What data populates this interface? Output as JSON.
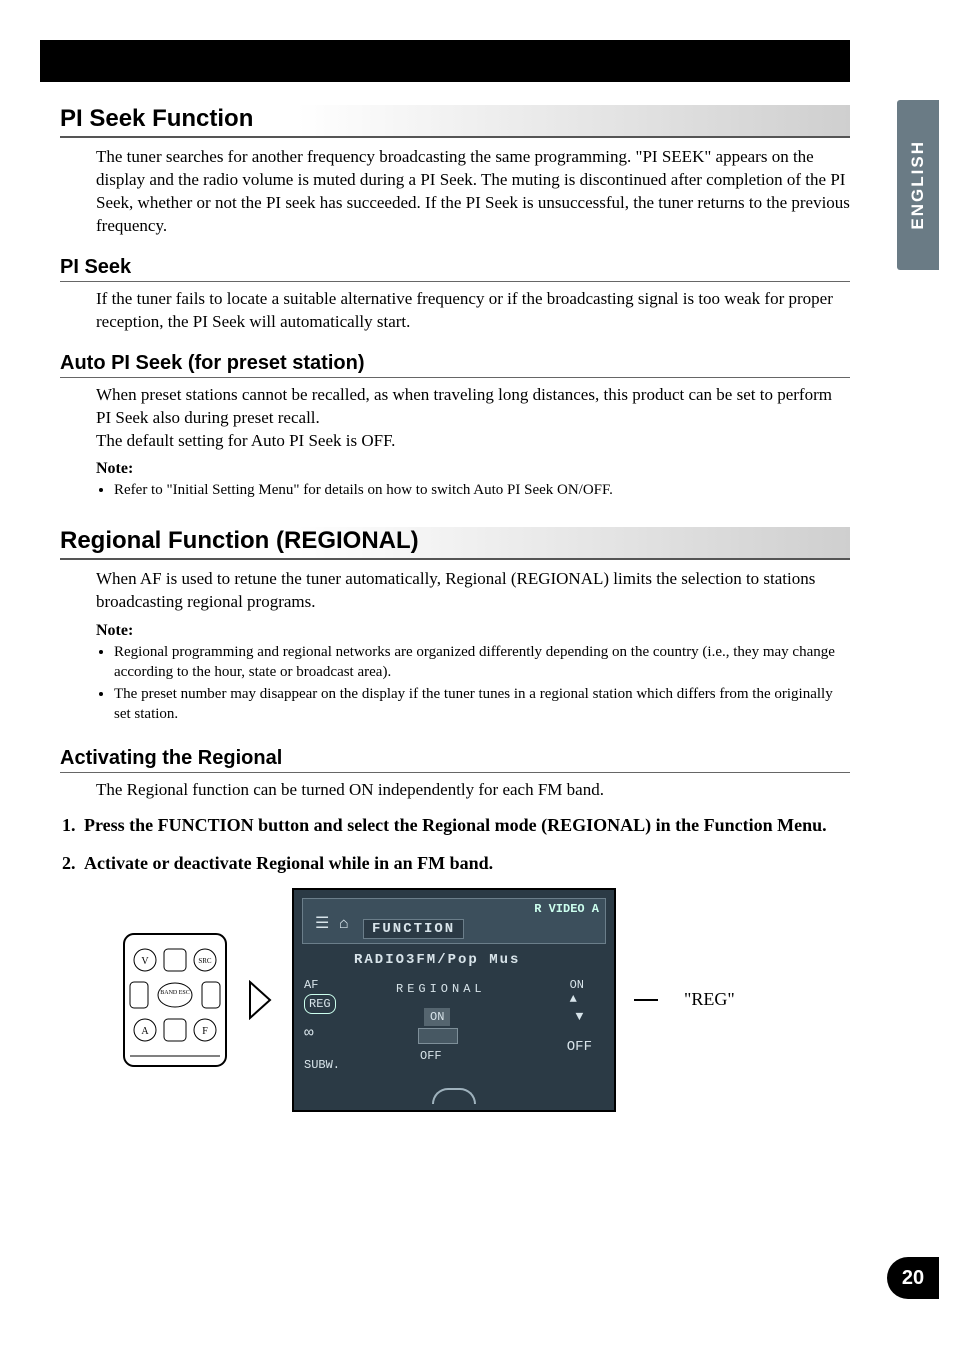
{
  "side_tab": "ENGLISH",
  "page_number": "20",
  "sections": {
    "pi_seek_function": {
      "title": "PI Seek Function",
      "body": "The tuner searches for another frequency broadcasting the same programming. \"PI SEEK\" appears on the display and the radio volume is muted during a PI Seek. The muting is discontinued after completion of the PI Seek, whether or not the PI seek has succeeded. If the PI Seek is unsuccessful, the tuner returns to the previous frequency."
    },
    "pi_seek": {
      "title": "PI Seek",
      "body": "If the tuner fails to locate a suitable alternative frequency or if the broadcasting signal is too weak for proper reception, the PI Seek will automatically start."
    },
    "auto_pi_seek": {
      "title": "Auto PI Seek (for preset station)",
      "body": "When preset stations cannot be recalled, as when traveling long distances, this product can be set to perform PI Seek also during preset recall.\nThe default setting for Auto PI Seek is OFF.",
      "note_label": "Note:",
      "notes": [
        "Refer to \"Initial Setting Menu\" for details on how to switch Auto PI Seek ON/OFF."
      ]
    },
    "regional_function": {
      "title": "Regional Function (REGIONAL)",
      "body": "When AF is used to retune the tuner automatically, Regional (REGIONAL) limits the selection to stations broadcasting regional programs.",
      "note_label": "Note:",
      "notes": [
        "Regional programming and regional networks are organized differently depending on the country (i.e., they may change according to the hour, state or broadcast area).",
        "The preset number may disappear on the display if the tuner tunes in a regional station which differs from the originally set station."
      ]
    },
    "activating_regional": {
      "title": "Activating the Regional",
      "body": "The Regional function can be turned ON independently for each FM band.",
      "steps": [
        "Press the FUNCTION button and select the Regional mode (REGIONAL) in the Function Menu.",
        "Activate or deactivate Regional while in an FM band."
      ]
    }
  },
  "remote_labels": {
    "v": "V",
    "src": "SRC",
    "band": "BAND\nESC",
    "a": "A",
    "f": "F"
  },
  "display": {
    "video": "R VIDEO A",
    "function": "FUNCTION",
    "line1": "RADIO3FM/Pop   Mus",
    "left_af": "AF",
    "left_reg": "REG",
    "left_loop": "∞",
    "left_subw": "SUBW.",
    "regional": "REGIONAL",
    "on_small": "ON",
    "up_tri": "▲",
    "dial_on": "ON",
    "dial_off": "OFF",
    "right_down": "▼",
    "right_off": "OFF"
  },
  "callout": "\"REG\""
}
